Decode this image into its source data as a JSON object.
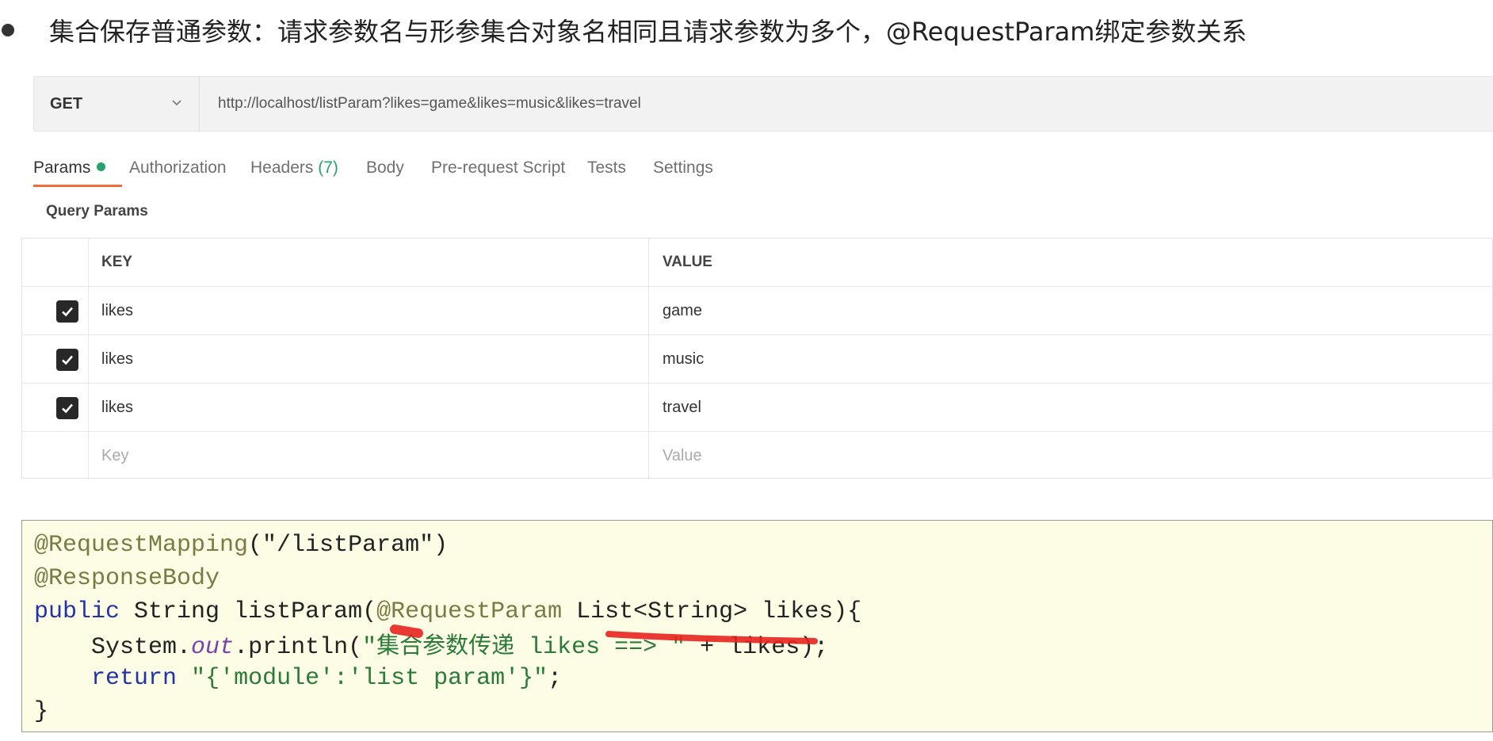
{
  "heading": {
    "text": "集合保存普通参数：请求参数名与形参集合对象名相同且请求参数为多个，@RequestParam绑定参数关系"
  },
  "request": {
    "method": "GET",
    "url": "http://localhost/listParam?likes=game&likes=music&likes=travel"
  },
  "tabs": [
    {
      "label": "Params",
      "active": true
    },
    {
      "label": "Authorization"
    },
    {
      "label": "Headers",
      "count": "(7)"
    },
    {
      "label": "Body"
    },
    {
      "label": "Pre-request Script"
    },
    {
      "label": "Tests"
    },
    {
      "label": "Settings"
    }
  ],
  "query_params": {
    "title": "Query Params",
    "headers": {
      "key": "KEY",
      "value": "VALUE"
    },
    "rows": [
      {
        "key": "likes",
        "value": "game",
        "checked": true
      },
      {
        "key": "likes",
        "value": "music",
        "checked": true
      },
      {
        "key": "likes",
        "value": "travel",
        "checked": true
      }
    ],
    "placeholder": {
      "key": "Key",
      "value": "Value"
    }
  },
  "code": {
    "line1": {
      "ann": "@RequestMapping",
      "rest": "(\"/listParam\")"
    },
    "line2": {
      "ann": "@ResponseBody"
    },
    "line3": {
      "kw": "public",
      "mid": " String listParam(",
      "ann": "@RequestParam",
      "rest": " List<String> likes){"
    },
    "line4": {
      "indent": "    ",
      "sys": "System.",
      "field": "out",
      "call": ".println(",
      "str_quote": "\"",
      "str_cn": "集合参数传递",
      "str_rest": " likes ==> \"",
      "rest": " + likes);"
    },
    "line5": {
      "indent": "    ",
      "kw": "return",
      "sp": " ",
      "str": "\"{'module':'list param'}\"",
      "rest": ";"
    },
    "line6": {
      "text": "}"
    }
  },
  "colors": {
    "accent_tab": "#f26b3a",
    "green": "#26a36b",
    "scribble": "#e8231e",
    "code_bg": "#fdfde6"
  }
}
